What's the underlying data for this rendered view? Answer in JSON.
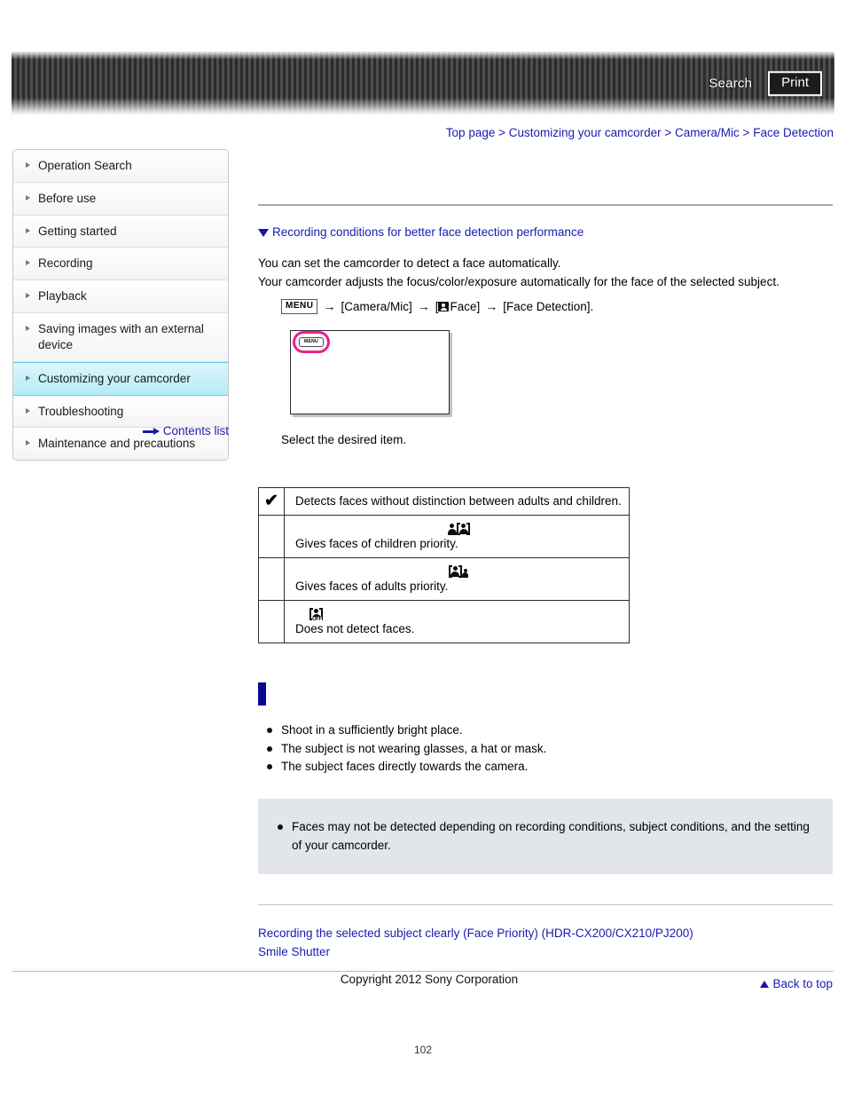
{
  "header": {
    "search_label": "Search",
    "print_label": "Print"
  },
  "breadcrumb": {
    "items": [
      "Top page",
      "Customizing your camcorder",
      "Camera/Mic",
      "Face Detection"
    ],
    "separator": ">"
  },
  "sidebar": {
    "items": [
      {
        "label": "Operation Search",
        "active": false
      },
      {
        "label": "Before use",
        "active": false
      },
      {
        "label": "Getting started",
        "active": false
      },
      {
        "label": "Recording",
        "active": false
      },
      {
        "label": "Playback",
        "active": false
      },
      {
        "label": "Saving images with an external device",
        "active": false
      },
      {
        "label": "Customizing your camcorder",
        "active": true
      },
      {
        "label": "Troubleshooting",
        "active": false
      },
      {
        "label": "Maintenance and precautions",
        "active": false
      }
    ],
    "contents_list_label": "Contents list"
  },
  "main": {
    "anchor_link": "Recording conditions for better face detection performance",
    "intro_line1": "You can set the camcorder to detect a face automatically.",
    "intro_line2": "Your camcorder adjusts the focus/color/exposure automatically for the face of the selected subject.",
    "menu_path": {
      "menu_chip": "MENU",
      "arrow": "→",
      "step1": "[Camera/Mic]",
      "step2_prefix": "[",
      "step2_label": "Face]",
      "step3": "[Face Detection]."
    },
    "screen_illustration": {
      "menu_chip": "MENU"
    },
    "caption": "Select the desired item.",
    "table": {
      "rows": [
        {
          "mark": "✔",
          "icon": "none",
          "text": "Detects faces without distinction between adults and children."
        },
        {
          "mark": "",
          "icon": "child-priority-icon",
          "text": "Gives faces of children priority."
        },
        {
          "mark": "",
          "icon": "adult-priority-icon",
          "text": "Gives faces of adults priority."
        },
        {
          "mark": "",
          "icon": "face-detection-off-icon",
          "text": "Does not detect faces."
        }
      ]
    },
    "conditions": {
      "bullets": [
        "Shoot in a sufficiently bright place.",
        "The subject is not wearing glasses, a hat or mask.",
        "The subject faces directly towards the camera."
      ]
    },
    "note": {
      "bullets": [
        "Faces may not be detected depending on recording conditions, subject conditions, and the setting of your camcorder."
      ]
    },
    "related_links": [
      "Recording the selected subject clearly (Face Priority) (HDR-CX200/CX210/PJ200)",
      "Smile Shutter"
    ],
    "back_to_top": "Back to top"
  },
  "footer": {
    "copyright": "Copyright 2012 Sony Corporation",
    "page_number": "102"
  },
  "colors": {
    "link_blue": "#1a1ab0",
    "accent_magenta": "#ee1d8e",
    "sidebar_active_cyan": "#b4ecf6",
    "note_bg": "#e2e5ea",
    "section_bar": "#0a0a91"
  }
}
